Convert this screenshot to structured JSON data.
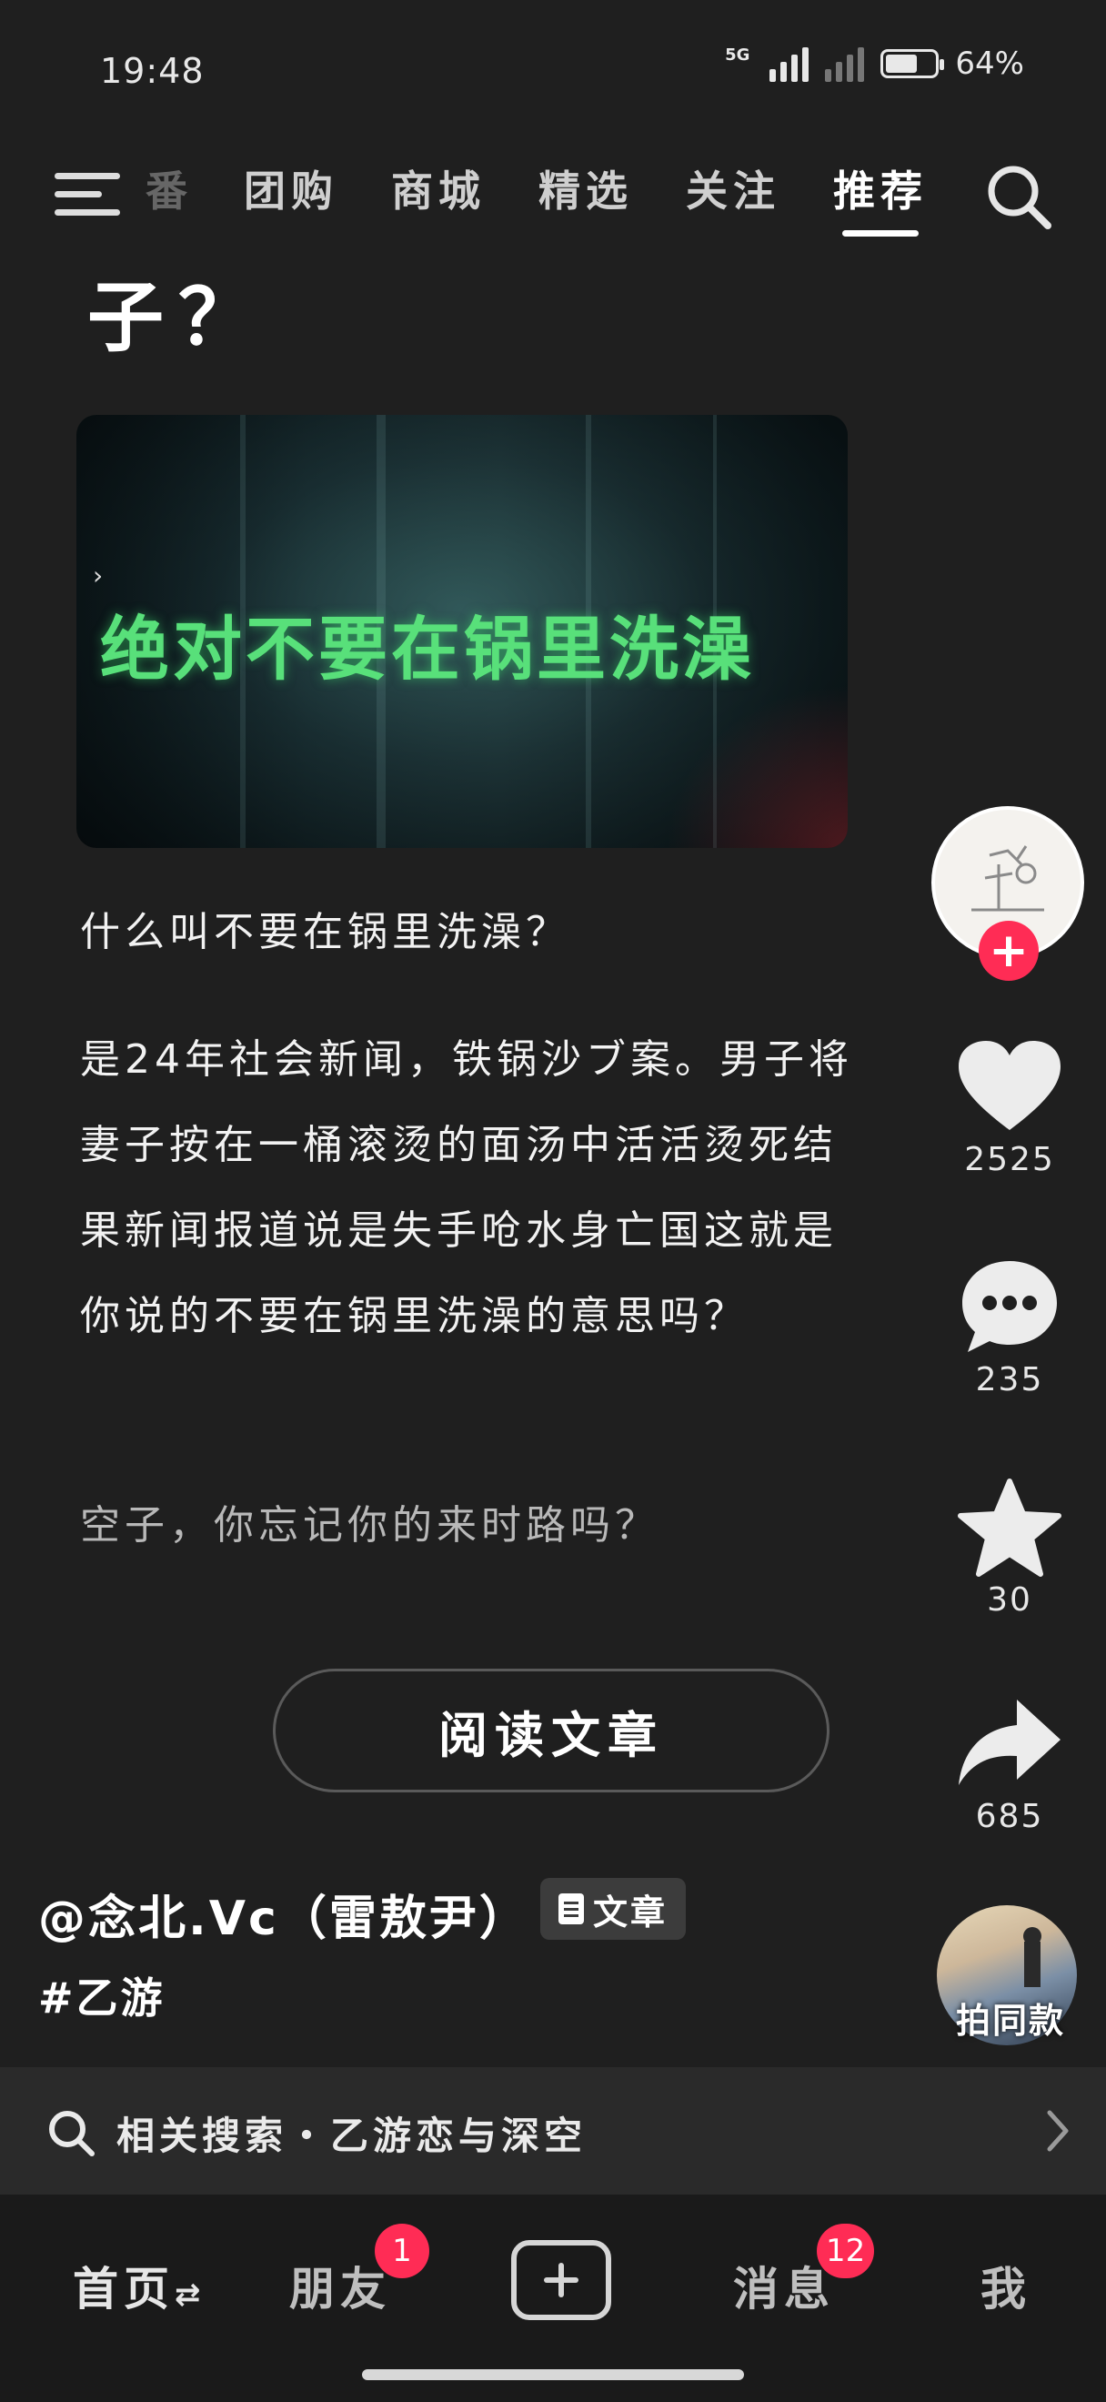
{
  "status_bar": {
    "time": "19:48",
    "network": "5G",
    "battery": "64%",
    "battery_level": 0.64
  },
  "top_nav": {
    "tabs": [
      "番",
      "团购",
      "商城",
      "精选",
      "关注",
      "推荐"
    ],
    "active_tab": "推荐"
  },
  "post": {
    "title_tail": "子？",
    "video_caption": "绝对不要在锅里洗澡",
    "paragraph_1": "什么叫不要在锅里洗澡？",
    "paragraph_2": "是24年社会新闻，铁锅沙ブ案。男子将妻子按在一桶滚烫的面汤中活活烫死结果新闻报道说是失手呛水身亡国这就是你说的不要在锅里洗澡的意思吗？",
    "paragraph_3": "空子，你忘记你的来时路吗？",
    "read_button": "阅读文章",
    "author": "@念北.Vc（雷敖尹）",
    "article_badge": "文章",
    "hashtag": "#乙游"
  },
  "actions": {
    "follow": "+",
    "likes": "2525",
    "comments": "235",
    "favorites": "30",
    "shares": "685",
    "same_style": "拍同款"
  },
  "related_search": {
    "text": "相关搜索・乙游恋与深空"
  },
  "bottom_nav": {
    "home": "首页",
    "home_suffix": "⇄",
    "friends": "朋友",
    "friends_badge": "1",
    "messages": "消息",
    "messages_badge": "12",
    "me": "我"
  },
  "colors": {
    "background": "#1f1f1f",
    "accent": "#ff2c55",
    "video_caption": "#58e07a"
  }
}
